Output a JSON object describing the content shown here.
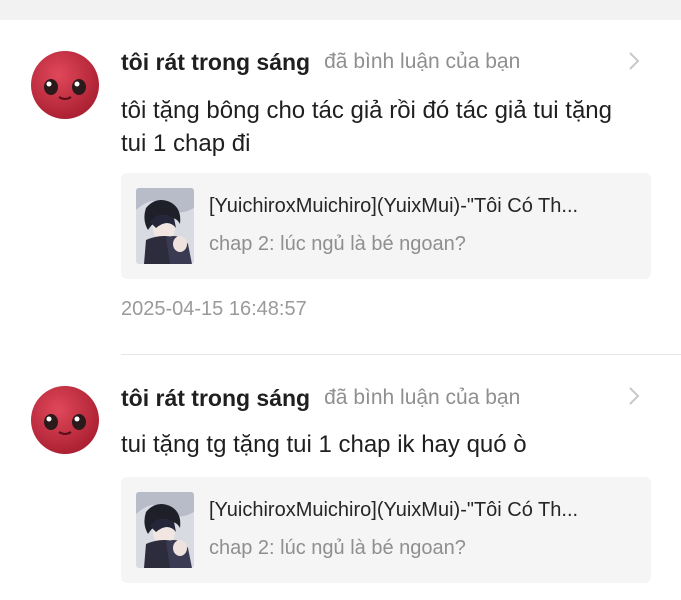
{
  "comments": [
    {
      "username": "tôi rát trong sáng",
      "action": "đã bình luận của bạn",
      "text": "tôi tặng bông cho tác giả rồi đó tác giả tui tặng tui 1 chap đi",
      "card": {
        "title": "[YuichiroxMuichiro](YuixMui)-\"Tôi Có Th...",
        "subtitle": "chap 2: lúc ngủ là bé ngoan?"
      },
      "timestamp": "2025-04-15 16:48:57"
    },
    {
      "username": "tôi rát trong sáng",
      "action": "đã bình luận của bạn",
      "text": "tui tặng tg tặng tui 1 chap ik hay quó ò",
      "card": {
        "title": "[YuichiroxMuichiro](YuixMui)-\"Tôi Có Th...",
        "subtitle": "chap 2: lúc ngủ là bé ngoan?"
      }
    }
  ],
  "colors": {
    "avatar": "#c6283a",
    "card_bg": "#f5f5f5",
    "muted_text": "#8f8f8f"
  },
  "icons": {
    "avatar": "red-creature-avatar",
    "chevron": "chevron-right-icon",
    "thumbnail": "manga-cover-thumbnail"
  }
}
